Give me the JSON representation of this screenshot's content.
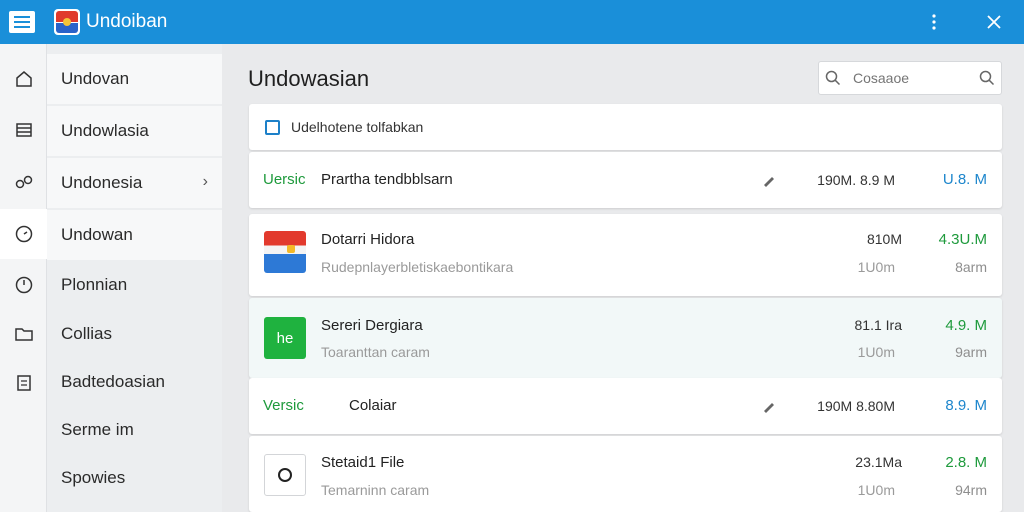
{
  "app": {
    "title": "Undoiban"
  },
  "rail": {
    "icons": [
      "home-icon",
      "list-icon",
      "share-icon",
      "clock-icon",
      "gauge-icon",
      "folder-icon",
      "document-icon"
    ]
  },
  "nav": {
    "items": [
      {
        "label": "Undovan"
      },
      {
        "label": "Undowlasia"
      },
      {
        "label": "Undonesia"
      },
      {
        "label": "Undowan"
      },
      {
        "label": "Plonnian"
      },
      {
        "label": "Collias"
      },
      {
        "label": "Badtedoasian"
      },
      {
        "label": "Serme im"
      },
      {
        "label": "Spowies"
      }
    ]
  },
  "main": {
    "title": "Undowasian",
    "search": {
      "placeholder": "Cosaaoe"
    },
    "header": {
      "label": "Udelhotene tolfabkan"
    },
    "rows": [
      {
        "version": "Uersic",
        "name": "Prartha tendbblsarn",
        "size": "190M. 8.9 M",
        "value": "U.8. M"
      },
      {
        "name": "Dotarri Hidora",
        "sub": "Rudepnlayerbletiskaebontikara",
        "size": "810M",
        "dim": "1U0m",
        "value": "4.3U.M",
        "sub_value": "8arm"
      },
      {
        "name": "Sereri Dergiara",
        "sub": "Toaranttan caram",
        "thumb_text": "he",
        "size": "81.1 Ira",
        "dim": "1U0m",
        "value": "4.9. M",
        "sub_value": "9arm"
      },
      {
        "version": "Versic",
        "name": "Colaiar",
        "size": "190M 8.80M",
        "value": "8.9. M"
      },
      {
        "name": "Stetaid1 File",
        "sub": "Temarninn caram",
        "size": "23.1Ma",
        "dim": "1U0m",
        "value": "2.8. M",
        "sub_value": "94rm"
      }
    ]
  }
}
